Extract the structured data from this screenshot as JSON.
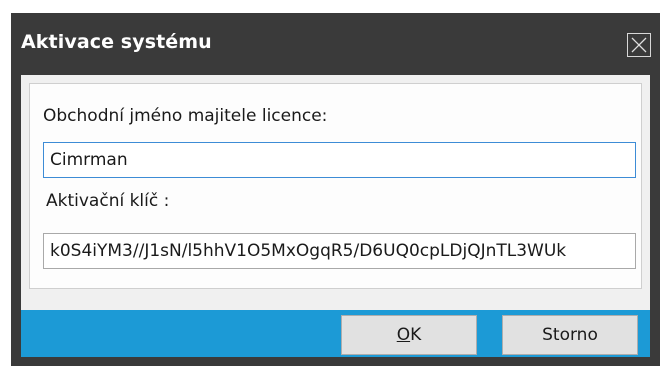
{
  "window": {
    "title": "Aktivace systému"
  },
  "icons": {
    "close": "close-icon"
  },
  "form": {
    "owner_label": "Obchodní jméno majitele licence:",
    "owner_value": "Cimrman",
    "key_label": "Aktivační klíč :",
    "key_value": "k0S4iYM3//J1sN/l5hhV1O5MxOgqR5/D6UQ0cpLDjQJnTL3WUk"
  },
  "buttons": {
    "ok_mnemonic": "O",
    "ok_rest": "K",
    "cancel_label": "Storno"
  },
  "colors": {
    "titlebar": "#3a3a3a",
    "footer": "#1c9ad6",
    "body": "#f0f0f0",
    "focus_border": "#3d8cd6"
  }
}
